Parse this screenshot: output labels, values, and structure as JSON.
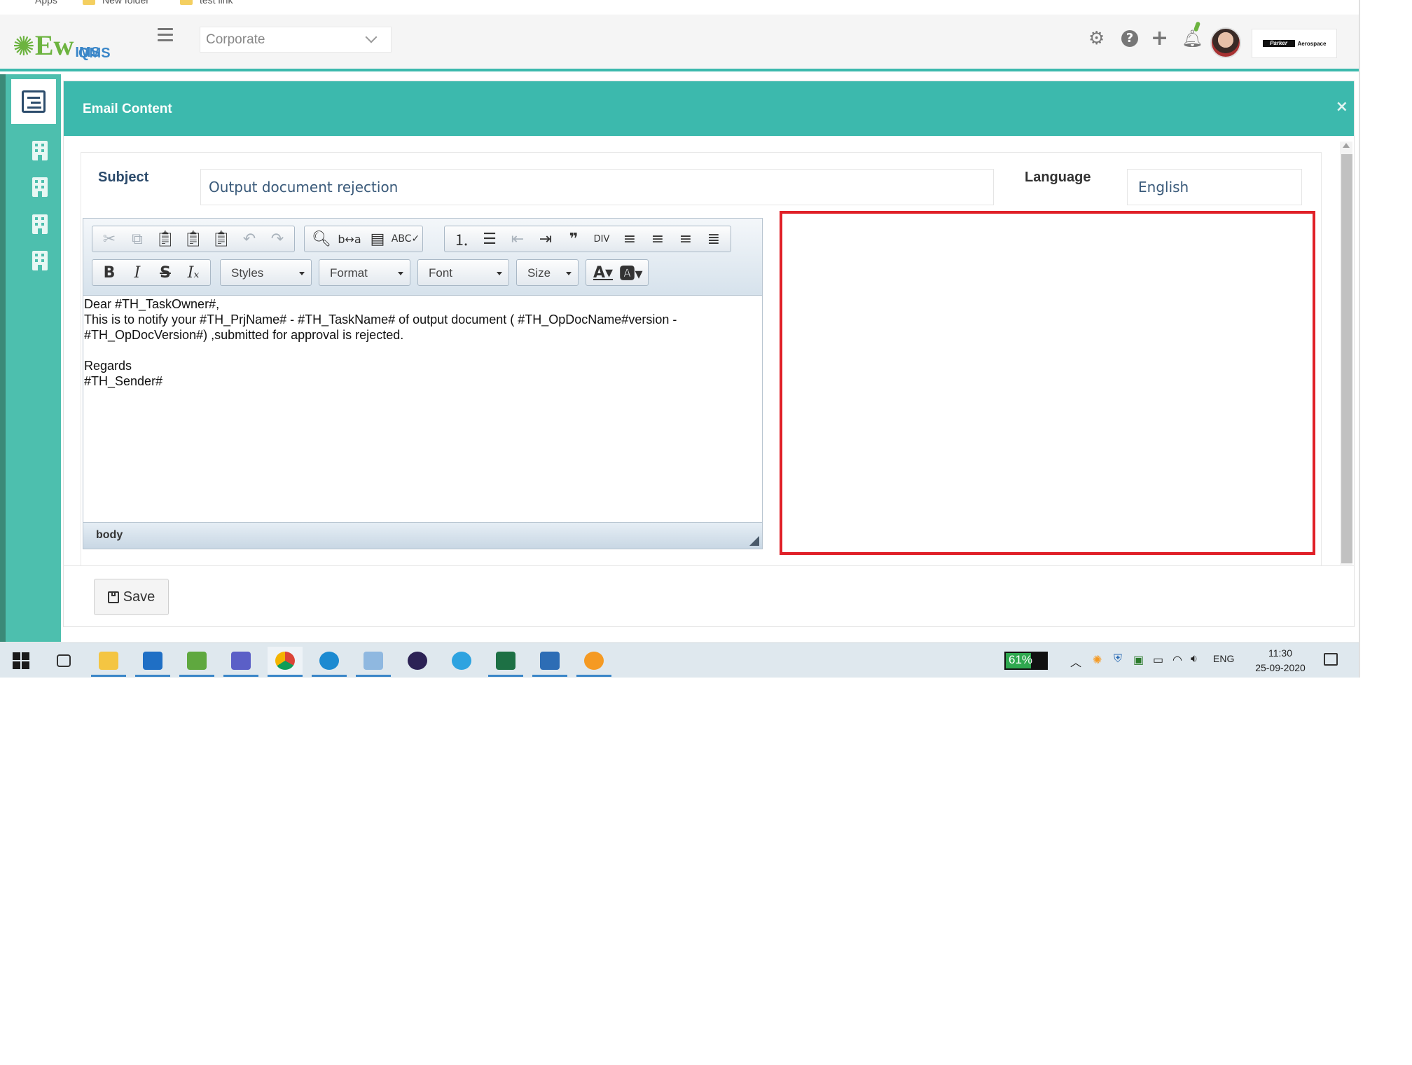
{
  "bookmarks": [
    {
      "label": "Apps",
      "icon": "apps-grid-icon"
    },
    {
      "label": "New folder",
      "icon": "folder-icon"
    },
    {
      "label": "test link",
      "icon": "folder-icon"
    }
  ],
  "header": {
    "logo_ew": "Ew",
    "logo_ims": "IMS",
    "logo_qms": "QMS",
    "site_select": "Corporate",
    "company_badge": "Parker",
    "company_badge_sub": "Aerospace"
  },
  "dialog": {
    "title": "Email Content",
    "close_label": "×",
    "subject_label": "Subject",
    "subject_value": "Output document rejection",
    "language_label": "Language",
    "language_value": "English",
    "save_label": "Save"
  },
  "editor": {
    "combos": {
      "styles": "Styles",
      "format": "Format",
      "font": "Font",
      "size": "Size"
    },
    "body_lines": [
      "Dear #TH_TaskOwner#,",
      "This is to notify your #TH_PrjName# - #TH_TaskName# of output document ( #TH_OpDocName#version -",
      "#TH_OpDocVersion#) ,submitted for approval is rejected.",
      "",
      "Regards",
      "#TH_Sender#"
    ],
    "path": "body"
  },
  "taskbar": {
    "battery": "61%",
    "language": "ENG",
    "time": "11:30",
    "date": "25-09-2020"
  },
  "colors": {
    "accent": "#3cb9ad",
    "highlight_box": "#e02028",
    "logo_green": "#6cb33f"
  }
}
